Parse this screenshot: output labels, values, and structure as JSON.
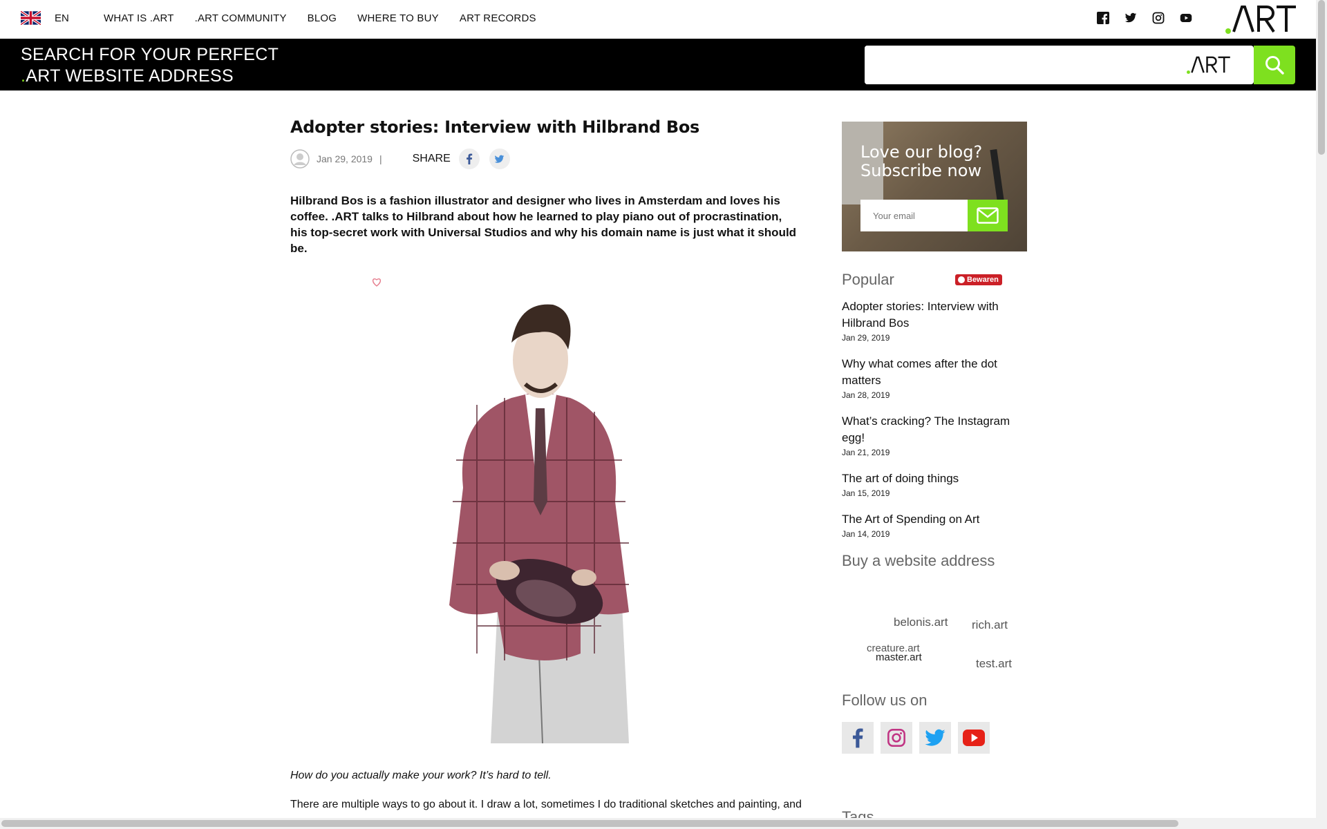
{
  "nav": {
    "language": "EN",
    "links": [
      "WHAT IS .ART",
      ".ART COMMUNITY",
      "BLOG",
      "WHERE TO BUY",
      "ART RECORDS"
    ],
    "social_icons": [
      "facebook-icon",
      "twitter-icon",
      "instagram-icon",
      "youtube-icon"
    ],
    "brand": ".ART"
  },
  "banner": {
    "title_line1": "SEARCH FOR YOUR PERFECT",
    "title_line2": "ART WEBSITE ADDRESS",
    "search_value": "",
    "search_suffix": ".ART",
    "accent": "#7ee01f"
  },
  "article": {
    "title": "Adopter stories: Interview with Hilbrand Bos",
    "date": "Jan 29, 2019",
    "separator": "|",
    "share_label": "SHARE",
    "lead": "Hilbrand Bos is a fashion illustrator and designer who lives in Amsterdam and loves his coffee. .ART talks to Hilbrand about how he learned to play piano out of procrastination, his top-secret work with Universal Studios and why his domain name is just what it should be.",
    "question": "How do you actually make your work? It’s hard to tell.",
    "paragraph": "There are multiple ways to go about it. I draw a lot, sometimes I do traditional sketches and painting, and"
  },
  "sidebar": {
    "subscribe_line1": "Love our blog?",
    "subscribe_line2": "Subscribe now",
    "email_placeholder": "Your email",
    "popular_heading": "Popular",
    "pin_label": "Bewaren",
    "popular": [
      {
        "title": "Adopter stories: Interview with Hilbrand Bos",
        "date": "Jan 29, 2019"
      },
      {
        "title": "Why what comes after the dot matters",
        "date": "Jan 28, 2019"
      },
      {
        "title": "What’s cracking? The Instagram egg!",
        "date": "Jan 21, 2019"
      },
      {
        "title": "The art of doing things",
        "date": "Jan 15, 2019"
      },
      {
        "title": "The Art of Spending on Art",
        "date": "Jan 14, 2019"
      }
    ],
    "buy_heading": "Buy a website address",
    "tags": [
      "belonis.art",
      "rich.art",
      "creature.art",
      "master.art",
      "test.art"
    ],
    "follow_heading": "Follow us on",
    "follow_icons": [
      "facebook-icon",
      "instagram-icon",
      "twitter-icon",
      "youtube-icon"
    ],
    "tags_heading": "Tags"
  }
}
